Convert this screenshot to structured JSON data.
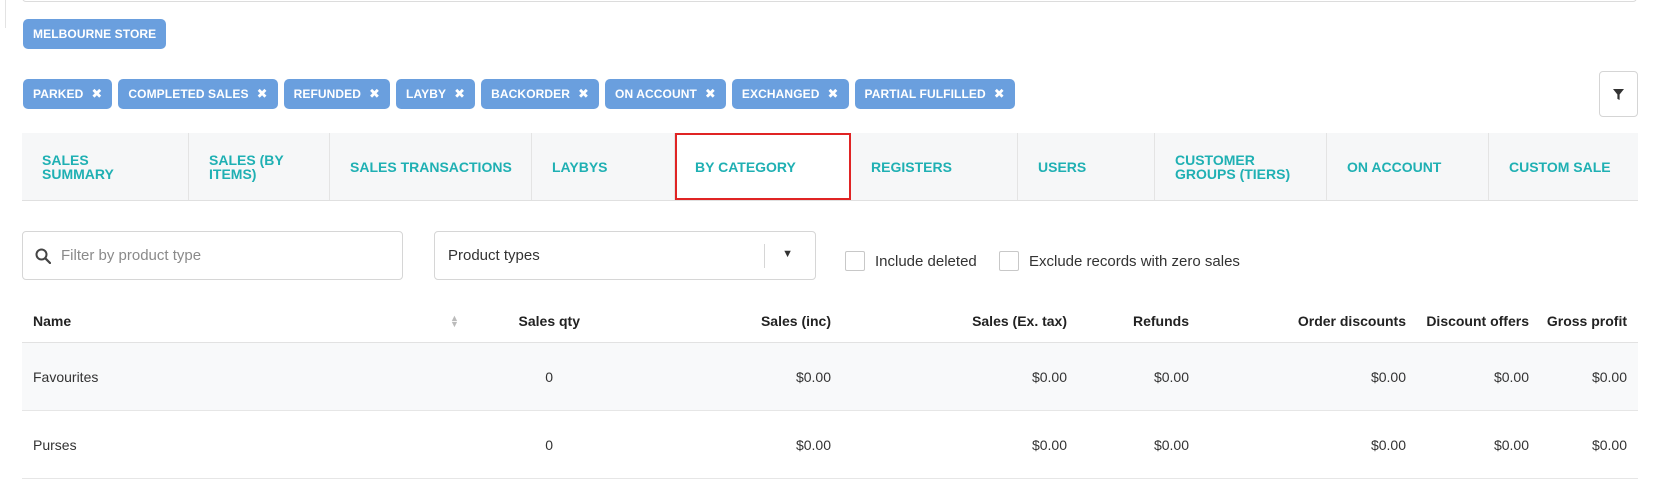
{
  "store_chip": "MELBOURNE STORE",
  "status_filters": [
    {
      "label": "PARKED"
    },
    {
      "label": "COMPLETED SALES"
    },
    {
      "label": "REFUNDED"
    },
    {
      "label": "LAYBY"
    },
    {
      "label": "BACKORDER"
    },
    {
      "label": "ON ACCOUNT"
    },
    {
      "label": "EXCHANGED"
    },
    {
      "label": "PARTIAL FULFILLED"
    }
  ],
  "remove_glyph": "✖",
  "tabs": [
    {
      "label": "SALES SUMMARY"
    },
    {
      "label": "SALES (BY ITEMS)"
    },
    {
      "label": "SALES TRANSACTIONS"
    },
    {
      "label": "LAYBYS"
    },
    {
      "label": "BY CATEGORY",
      "active": true
    },
    {
      "label": "REGISTERS"
    },
    {
      "label": "USERS"
    },
    {
      "label": "CUSTOMER GROUPS (TIERS)"
    },
    {
      "label": "ON ACCOUNT"
    },
    {
      "label": "CUSTOM SALE"
    }
  ],
  "search": {
    "placeholder": "Filter by product type",
    "value": ""
  },
  "product_type_select": {
    "value": "Product types"
  },
  "checkboxes": {
    "include_deleted": {
      "label": "Include deleted",
      "checked": false
    },
    "exclude_zero": {
      "label": "Exclude records with zero sales",
      "checked": false
    }
  },
  "table": {
    "headers": {
      "name": "Name",
      "sales_qty": "Sales qty",
      "sales_inc": "Sales (inc)",
      "sales_ex_tax": "Sales (Ex. tax)",
      "refunds": "Refunds",
      "order_discounts": "Order discounts",
      "discount_offers": "Discount offers",
      "gross_profit": "Gross profit"
    },
    "rows": [
      {
        "name": "Favourites",
        "sales_qty": "0",
        "sales_inc": "$0.00",
        "sales_ex_tax": "$0.00",
        "refunds": "$0.00",
        "order_discounts": "$0.00",
        "discount_offers": "$0.00",
        "gross_profit": "$0.00"
      },
      {
        "name": "Purses",
        "sales_qty": "0",
        "sales_inc": "$0.00",
        "sales_ex_tax": "$0.00",
        "refunds": "$0.00",
        "order_discounts": "$0.00",
        "discount_offers": "$0.00",
        "gross_profit": "$0.00"
      }
    ]
  },
  "colors": {
    "chip": "#6a9fde",
    "tab_text": "#1fb0b3",
    "active_outline": "#e02424"
  },
  "icons": {
    "search": "search-icon",
    "filter": "funnel-icon",
    "sort": "sort-icon",
    "dropdown": "caret-down-icon",
    "remove": "close-icon"
  }
}
